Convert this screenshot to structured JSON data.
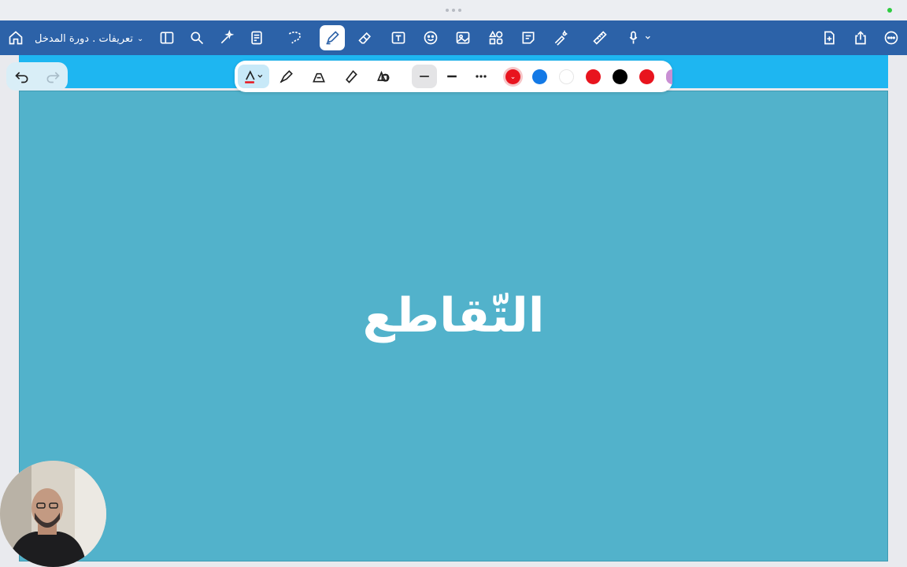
{
  "app": {
    "document_title": "تعريفات . دورة المدخل"
  },
  "toolbar": {
    "icons": [
      "home-icon",
      "document-title",
      "sidebar-icon",
      "search-icon",
      "magic-icon",
      "document-icon",
      "lasso-icon",
      "pen-icon",
      "eraser-icon",
      "text-box-icon",
      "sticker-icon",
      "image-icon",
      "shapes-icon",
      "sticky-note-icon",
      "laser-pointer-icon",
      "ruler-icon",
      "microphone-icon",
      "add-page-icon",
      "share-icon",
      "more-icon"
    ]
  },
  "pen_toolbar": {
    "colors": [
      "#e8141e",
      "#1379e6",
      "#ffffff",
      "#e8141e",
      "#000000",
      "#e8141e",
      "#c98fd3"
    ],
    "selected_color": "#e8141e"
  },
  "canvas": {
    "page_color": "#52b2cb",
    "strip_color": "#1eb6f1",
    "heading": "التّقاطع"
  },
  "colors": {
    "toolbar_bg": "#2c62a8",
    "accent": "#1eb6f1"
  }
}
